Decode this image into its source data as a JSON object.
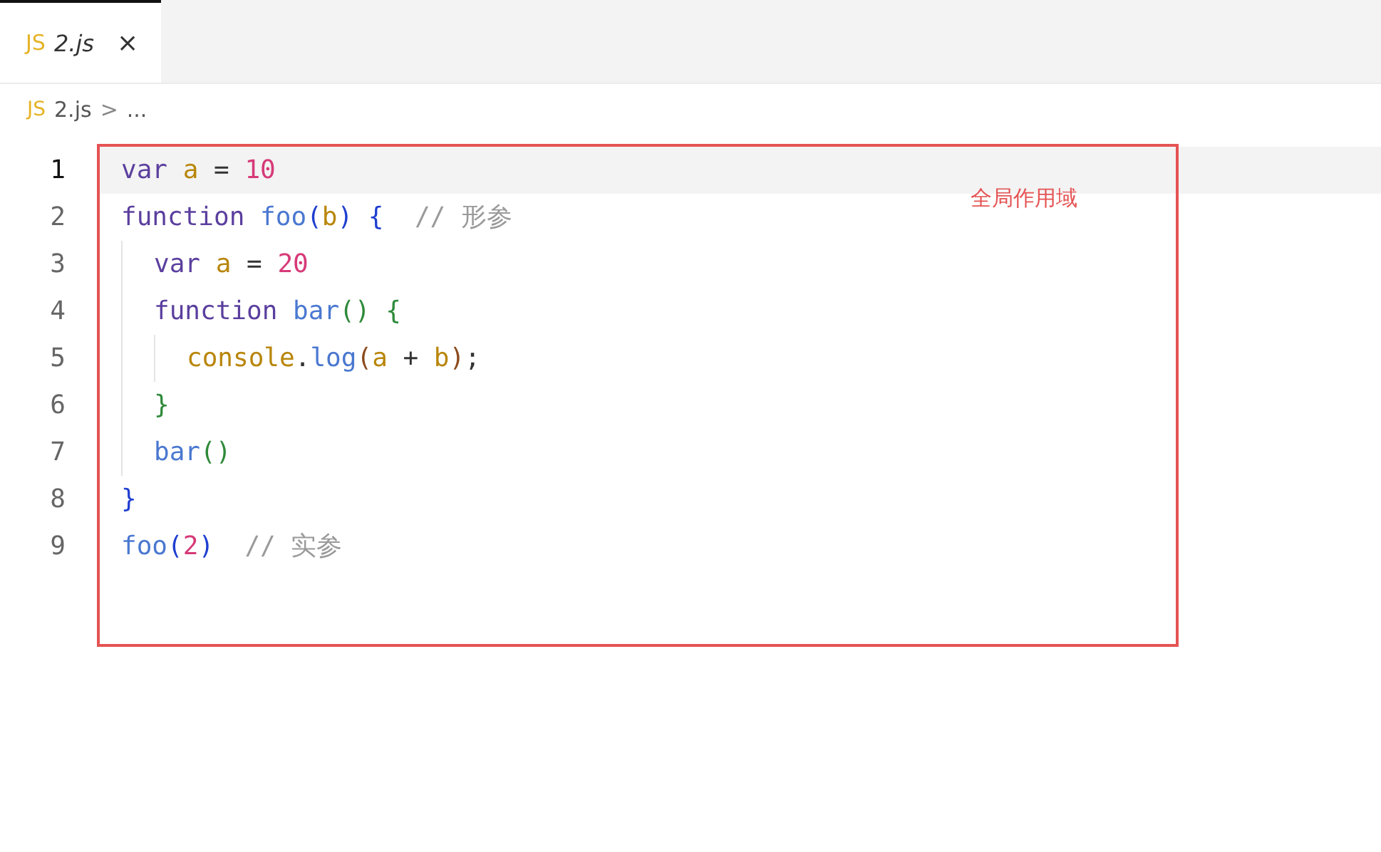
{
  "tabs": [
    {
      "icon": "JS",
      "label": "2.js",
      "close": "×",
      "selected": true
    }
  ],
  "breadcrumb": {
    "icon": "JS",
    "file": "2.js",
    "separator": ">",
    "rest": "..."
  },
  "lines": [
    {
      "number": "1",
      "selected": true,
      "tokens": [
        {
          "kind": "keyword",
          "text": "var "
        },
        {
          "kind": "variable",
          "text": "a"
        },
        {
          "kind": "plain",
          "text": " = "
        },
        {
          "kind": "number",
          "text": "10"
        }
      ]
    },
    {
      "number": "2",
      "selected": false,
      "tokens": [
        {
          "kind": "keyword",
          "text": "function "
        },
        {
          "kind": "function",
          "text": "foo"
        },
        {
          "kind": "bracket1",
          "text": "("
        },
        {
          "kind": "variable",
          "text": "b"
        },
        {
          "kind": "bracket1",
          "text": ")"
        },
        {
          "kind": "bracket1",
          "text": " {"
        },
        {
          "kind": "comment",
          "text": "  // 形参"
        }
      ],
      "children": [
        {
          "number": "3",
          "selected": false,
          "tokens": [
            {
              "kind": "keyword",
              "text": "var "
            },
            {
              "kind": "variable",
              "text": "a"
            },
            {
              "kind": "plain",
              "text": " = "
            },
            {
              "kind": "number",
              "text": "20"
            }
          ]
        },
        {
          "number": "4",
          "selected": false,
          "tokens": [
            {
              "kind": "keyword",
              "text": "function "
            },
            {
              "kind": "function",
              "text": "bar"
            },
            {
              "kind": "bracket2",
              "text": "()"
            },
            {
              "kind": "bracket2",
              "text": " {"
            }
          ],
          "children": [
            {
              "number": "5",
              "selected": false,
              "tokens": [
                {
                  "kind": "variable",
                  "text": "console"
                },
                {
                  "kind": "plain",
                  "text": "."
                },
                {
                  "kind": "function",
                  "text": "log"
                },
                {
                  "kind": "bracket3",
                  "text": "("
                },
                {
                  "kind": "variable",
                  "text": "a"
                },
                {
                  "kind": "plain",
                  "text": " + "
                },
                {
                  "kind": "variable",
                  "text": "b"
                },
                {
                  "kind": "bracket3",
                  "text": ")"
                },
                {
                  "kind": "plain",
                  "text": ";"
                }
              ]
            }
          ]
        },
        {
          "number": "6",
          "selected": false,
          "tokens": [
            {
              "kind": "bracket2",
              "text": "}"
            }
          ]
        },
        {
          "number": "7",
          "selected": false,
          "tokens": [
            {
              "kind": "function",
              "text": "bar"
            },
            {
              "kind": "bracket2",
              "text": "()"
            }
          ]
        }
      ]
    },
    {
      "number": "8",
      "selected": false,
      "tokens": [
        {
          "kind": "bracket1",
          "text": "}"
        }
      ]
    },
    {
      "number": "9",
      "selected": false,
      "tokens": [
        {
          "kind": "function",
          "text": "foo"
        },
        {
          "kind": "bracket1",
          "text": "("
        },
        {
          "kind": "number",
          "text": "2"
        },
        {
          "kind": "bracket1",
          "text": ")"
        },
        {
          "kind": "comment",
          "text": "  // 实参"
        }
      ]
    }
  ],
  "annotation": {
    "label": "全局作用域"
  }
}
